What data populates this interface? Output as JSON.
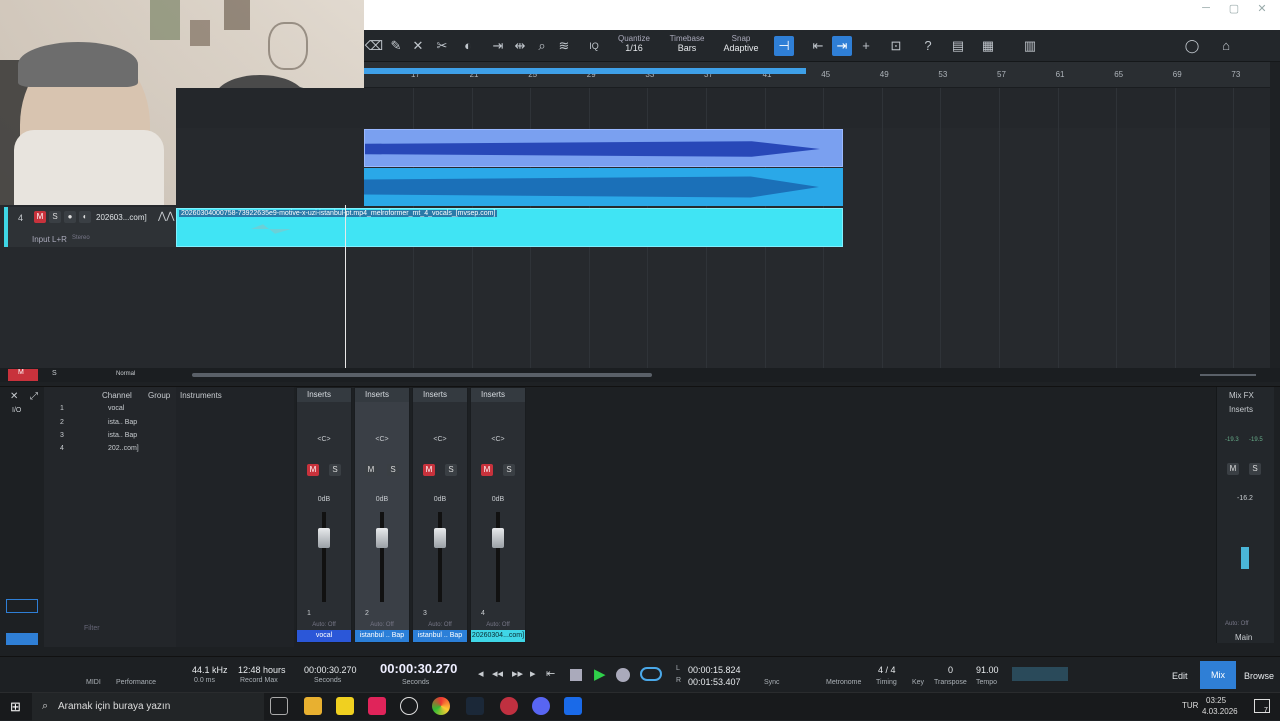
{
  "toolbar": {
    "quantize_label": "Quantize",
    "quantize_value": "1/16",
    "timebase_label": "Timebase",
    "timebase_value": "Bars",
    "snap_label": "Snap",
    "snap_value": "Adaptive",
    "iq_label": "IQ"
  },
  "ruler": {
    "ticks": [
      "17",
      "21",
      "25",
      "29",
      "33",
      "37",
      "41",
      "45",
      "49",
      "53",
      "57",
      "61",
      "65",
      "69",
      "73"
    ]
  },
  "tracks": {
    "track4": {
      "number": "4",
      "name": "202603...com]",
      "input": "Input L+R",
      "mode": "Stereo"
    },
    "clip_title": "20260304000758-73922635e9-motive-x-uzi-istanbul-pt.mp4_melroformer_mt_4_vocals_[mvsep.com]"
  },
  "status_row": {
    "m": "M",
    "s": "S",
    "mode": "Normal"
  },
  "mixer_panel": {
    "tabs": [
      "Channel",
      "Group",
      "Instruments"
    ],
    "channel_list": [
      {
        "num": "1",
        "name": "vocal"
      },
      {
        "num": "2",
        "name": "ista.. Bap"
      },
      {
        "num": "3",
        "name": "ista.. Bap"
      },
      {
        "num": "4",
        "name": "202..com]"
      }
    ],
    "filter_placeholder": "Filter",
    "io_label": "I/O",
    "strips": [
      {
        "insert": "Inserts",
        "pan": "<C>",
        "vol": "0dB",
        "num": "1",
        "auto": "Auto: Off",
        "name": "vocal",
        "color": "#2b3fd8"
      },
      {
        "insert": "Inserts",
        "pan": "<C>",
        "vol": "0dB",
        "num": "2",
        "auto": "Auto: Off",
        "name": "istanbul .. Bap",
        "color": "#2b7fd8"
      },
      {
        "insert": "Inserts",
        "pan": "<C>",
        "vol": "0dB",
        "num": "3",
        "auto": "Auto: Off",
        "name": "istanbul .. Bap",
        "color": "#2b7fd8"
      },
      {
        "insert": "Inserts",
        "pan": "<C>",
        "vol": "0dB",
        "num": "4",
        "auto": "Auto: Off",
        "name": "20260304...com]",
        "color": "#3fd6e6"
      }
    ],
    "main": {
      "fx": "Mix FX",
      "insert": "Inserts",
      "peak_l": "-19.3",
      "peak_r": "-19.5",
      "vol": "-16.2",
      "auto": "Auto: Off",
      "name": "Main"
    }
  },
  "transport": {
    "sample_rate": "44.1 kHz",
    "latency": "0.0 ms",
    "record_hours": "12:48 hours",
    "record_max": "Record Max",
    "midi": "MIDI",
    "performance": "Performance",
    "seconds_small": "00:00:30.270",
    "seconds_small_label": "Seconds",
    "time_big": "00:00:30.270",
    "time_big_label": "Seconds",
    "l_time": "00:00:15.824",
    "r_time": "00:01:53.407",
    "l": "L",
    "r": "R",
    "sync": "Sync",
    "metronome": "Metronome",
    "timing": "Timing",
    "signature": "4 / 4",
    "key": "Key",
    "key_value": "",
    "transpose": "Transpose",
    "transpose_value": "0",
    "tempo": "Tempo",
    "tempo_value": "91.00",
    "edit": "Edit",
    "mix": "Mix",
    "browse": "Browse"
  },
  "taskbar": {
    "search_placeholder": "Aramak için buraya yazın",
    "lang": "TUR",
    "time": "03:25",
    "date": "4.03.2026",
    "badge": "7"
  },
  "colors": {
    "accent": "#2f7fd6",
    "cyan_clip": "#3fe0f0",
    "blue_clip": "#5a7fe0",
    "mute_red": "#c8323c"
  }
}
